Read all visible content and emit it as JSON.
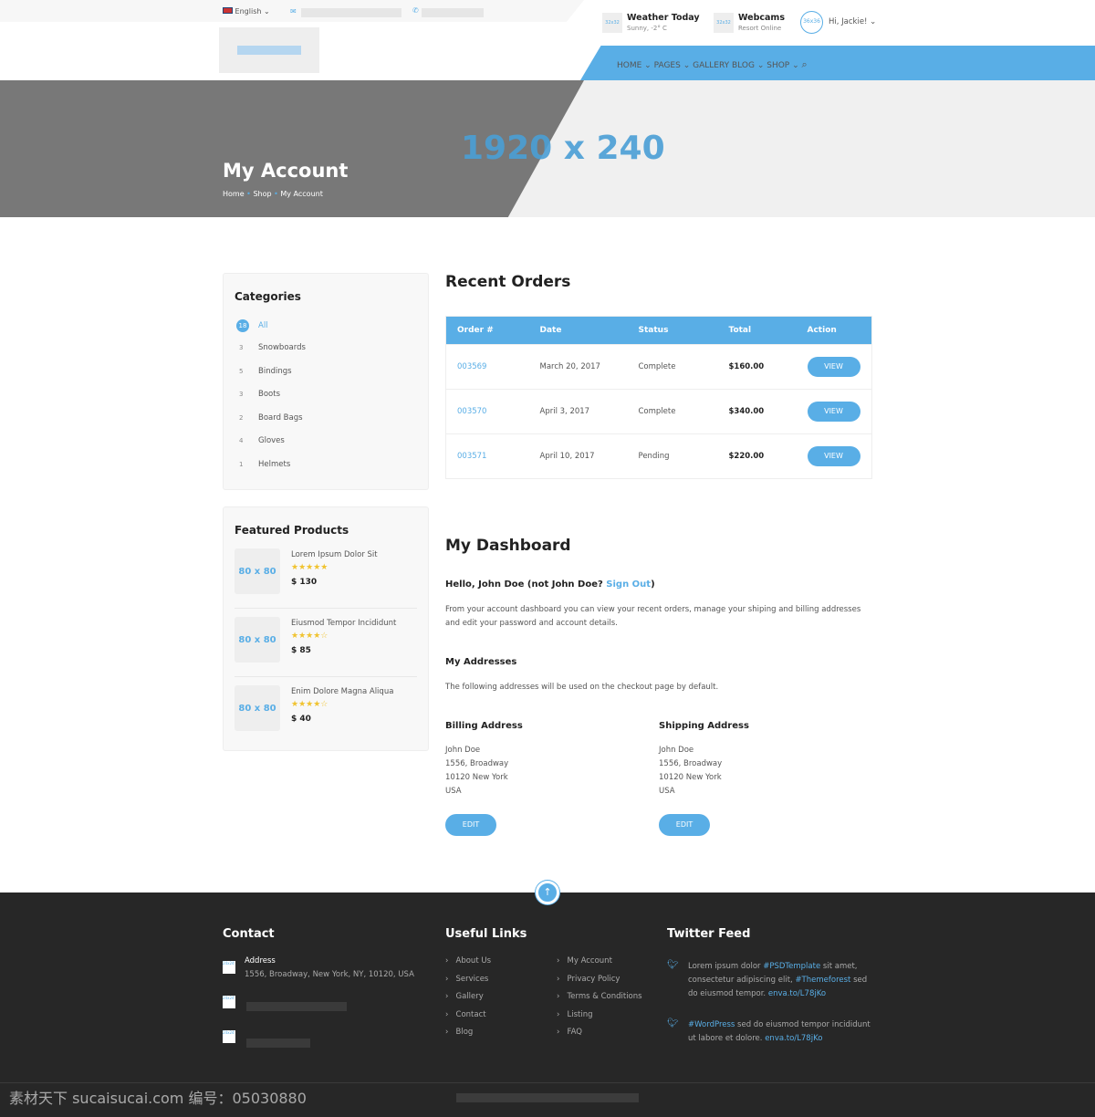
{
  "topbar": {
    "language": "English"
  },
  "header": {
    "weather": {
      "thumb": "32x32",
      "title": "Weather Today",
      "sub": "Sunny, -2° C"
    },
    "webcams": {
      "thumb": "32x32",
      "title": "Webcams",
      "sub": "Resort Online"
    },
    "avatar": "36x36",
    "greeting": "Hi, Jackie!"
  },
  "nav": {
    "items": [
      "HOME",
      "PAGES",
      "GALLERY",
      "BLOG",
      "SHOP"
    ]
  },
  "hero": {
    "title": "My Account",
    "placeholder": "1920 x 240",
    "breadcrumb": [
      "Home",
      "Shop",
      "My Account"
    ]
  },
  "categories": {
    "title": "Categories",
    "items": [
      {
        "count": "18",
        "label": "All"
      },
      {
        "count": "3",
        "label": "Snowboards"
      },
      {
        "count": "5",
        "label": "Bindings"
      },
      {
        "count": "3",
        "label": "Boots"
      },
      {
        "count": "2",
        "label": "Board Bags"
      },
      {
        "count": "4",
        "label": "Gloves"
      },
      {
        "count": "1",
        "label": "Helmets"
      }
    ]
  },
  "featured": {
    "title": "Featured Products",
    "items": [
      {
        "thumb": "80 x 80",
        "name": "Lorem Ipsum Dolor Sit",
        "rating": 5,
        "price": "$ 130"
      },
      {
        "thumb": "80 x 80",
        "name": "Eiusmod Tempor Incididunt",
        "rating": 4,
        "price": "$ 85"
      },
      {
        "thumb": "80 x 80",
        "name": "Enim Dolore Magna Aliqua",
        "rating": 4,
        "price": "$ 40"
      }
    ]
  },
  "orders": {
    "title": "Recent Orders",
    "columns": [
      "Order #",
      "Date",
      "Status",
      "Total",
      "Action"
    ],
    "rows": [
      {
        "id": "003569",
        "date": "March 20, 2017",
        "status": "Complete",
        "total": "$160.00",
        "action": "VIEW"
      },
      {
        "id": "003570",
        "date": "April 3, 2017",
        "status": "Complete",
        "total": "$340.00",
        "action": "VIEW"
      },
      {
        "id": "003571",
        "date": "April 10, 2017",
        "status": "Pending",
        "total": "$220.00",
        "action": "VIEW"
      }
    ]
  },
  "dashboard": {
    "title": "My Dashboard",
    "hello": "Hello, John Doe (not John Doe?",
    "signout": "Sign Out",
    "hello_end": ")",
    "intro": "From your account dashboard you can view your recent orders, manage your shiping and billing addresses and edit your password and account details.",
    "addresses_title": "My Addresses",
    "addresses_note": "The following addresses will be used on the checkout page by default.",
    "billing": {
      "title": "Billing Address",
      "lines": [
        "John Doe",
        "1556, Broadway",
        "10120 New York",
        "USA"
      ],
      "button": "EDIT"
    },
    "shipping": {
      "title": "Shipping Address",
      "lines": [
        "John Doe",
        "1556, Broadway",
        "10120 New York",
        "USA"
      ],
      "button": "EDIT"
    }
  },
  "footer": {
    "contact": {
      "title": "Contact",
      "icon": "24x24",
      "address_label": "Address",
      "address": "1556, Broadway, New York, NY, 10120, USA"
    },
    "links": {
      "title": "Useful Links",
      "col1": [
        "About Us",
        "Services",
        "Gallery",
        "Contact",
        "Blog"
      ],
      "col2": [
        "My Account",
        "Privacy Policy",
        "Terms & Conditions",
        "Listing",
        "FAQ"
      ]
    },
    "twitter": {
      "title": "Twitter Feed",
      "t1": [
        "Lorem ipsum dolor ",
        "#PSDTemplate",
        " sit amet, consectetur adipiscing elit, ",
        "#Themeforest",
        " sed do eiusmod tempor. ",
        "enva.to/L78jKo"
      ],
      "t2": [
        "#WordPress",
        " sed do eiusmod tempor incididunt ut labore et dolore. ",
        "enva.to/L78jKo"
      ]
    }
  },
  "watermark": "素材天下 sucaisucai.com  编号：05030880",
  "colors": {
    "accent": "#59aee6",
    "footer": "#272727",
    "hero": "#787878"
  }
}
